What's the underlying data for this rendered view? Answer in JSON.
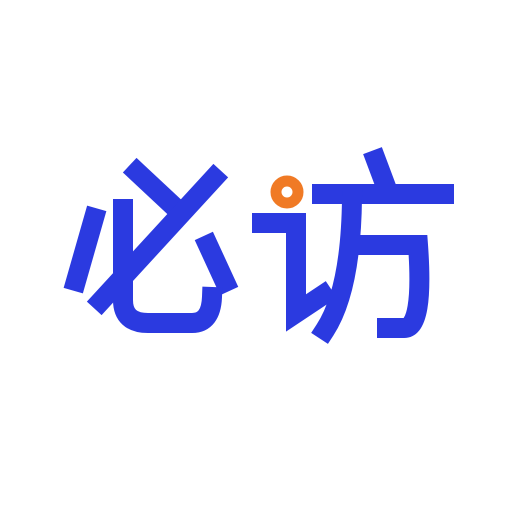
{
  "logo": {
    "text": "必访",
    "colors": {
      "primary": "#2B3AE0",
      "accent": "#F07A25",
      "background": "#FFFFFF"
    }
  }
}
